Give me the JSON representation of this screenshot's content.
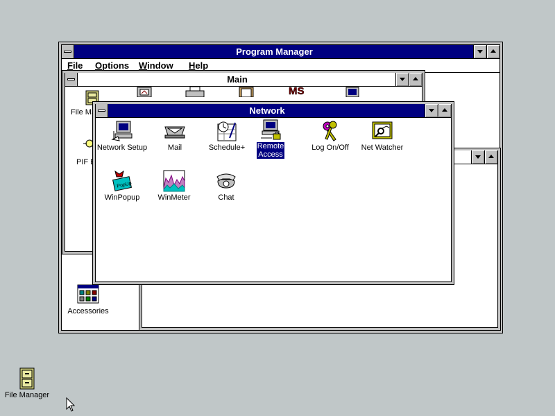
{
  "program_manager": {
    "title": "Program Manager",
    "menu": [
      {
        "label": "File",
        "underline": "F",
        "rest": "ile"
      },
      {
        "label": "Options",
        "underline": "O",
        "rest": "ptions"
      },
      {
        "label": "Window",
        "underline": "W",
        "rest": "indow"
      },
      {
        "label": "Help",
        "underline": "H",
        "rest": "elp"
      }
    ]
  },
  "main_group": {
    "title": "Main",
    "visible_labels": {
      "file_manager": "File Ma",
      "pif_editor": "PIF E"
    }
  },
  "accessories_group": {
    "label": "Accessories"
  },
  "network_group": {
    "title": "Network",
    "icons": [
      {
        "label": "Network Setup",
        "icon": "network-setup-icon"
      },
      {
        "label": "Mail",
        "icon": "mail-icon"
      },
      {
        "label": "Schedule+",
        "icon": "schedule-plus-icon"
      },
      {
        "label_line1": "Remote",
        "label_line2": "Access",
        "icon": "remote-access-icon",
        "selected": true
      },
      {
        "label": "Log On/Off",
        "icon": "logon-logoff-icon"
      },
      {
        "label": "Net Watcher",
        "icon": "net-watcher-icon"
      },
      {
        "label": "WinPopup",
        "icon": "winpopup-icon"
      },
      {
        "label": "WinMeter",
        "icon": "winmeter-icon"
      },
      {
        "label": "Chat",
        "icon": "chat-icon"
      }
    ]
  },
  "desktop": {
    "minimized_app": {
      "label": "File Manager",
      "icon": "file-cabinet-icon"
    }
  },
  "colors": {
    "desktop": "#c0c7c8",
    "active_title": "#000080",
    "selection": "#000080"
  }
}
